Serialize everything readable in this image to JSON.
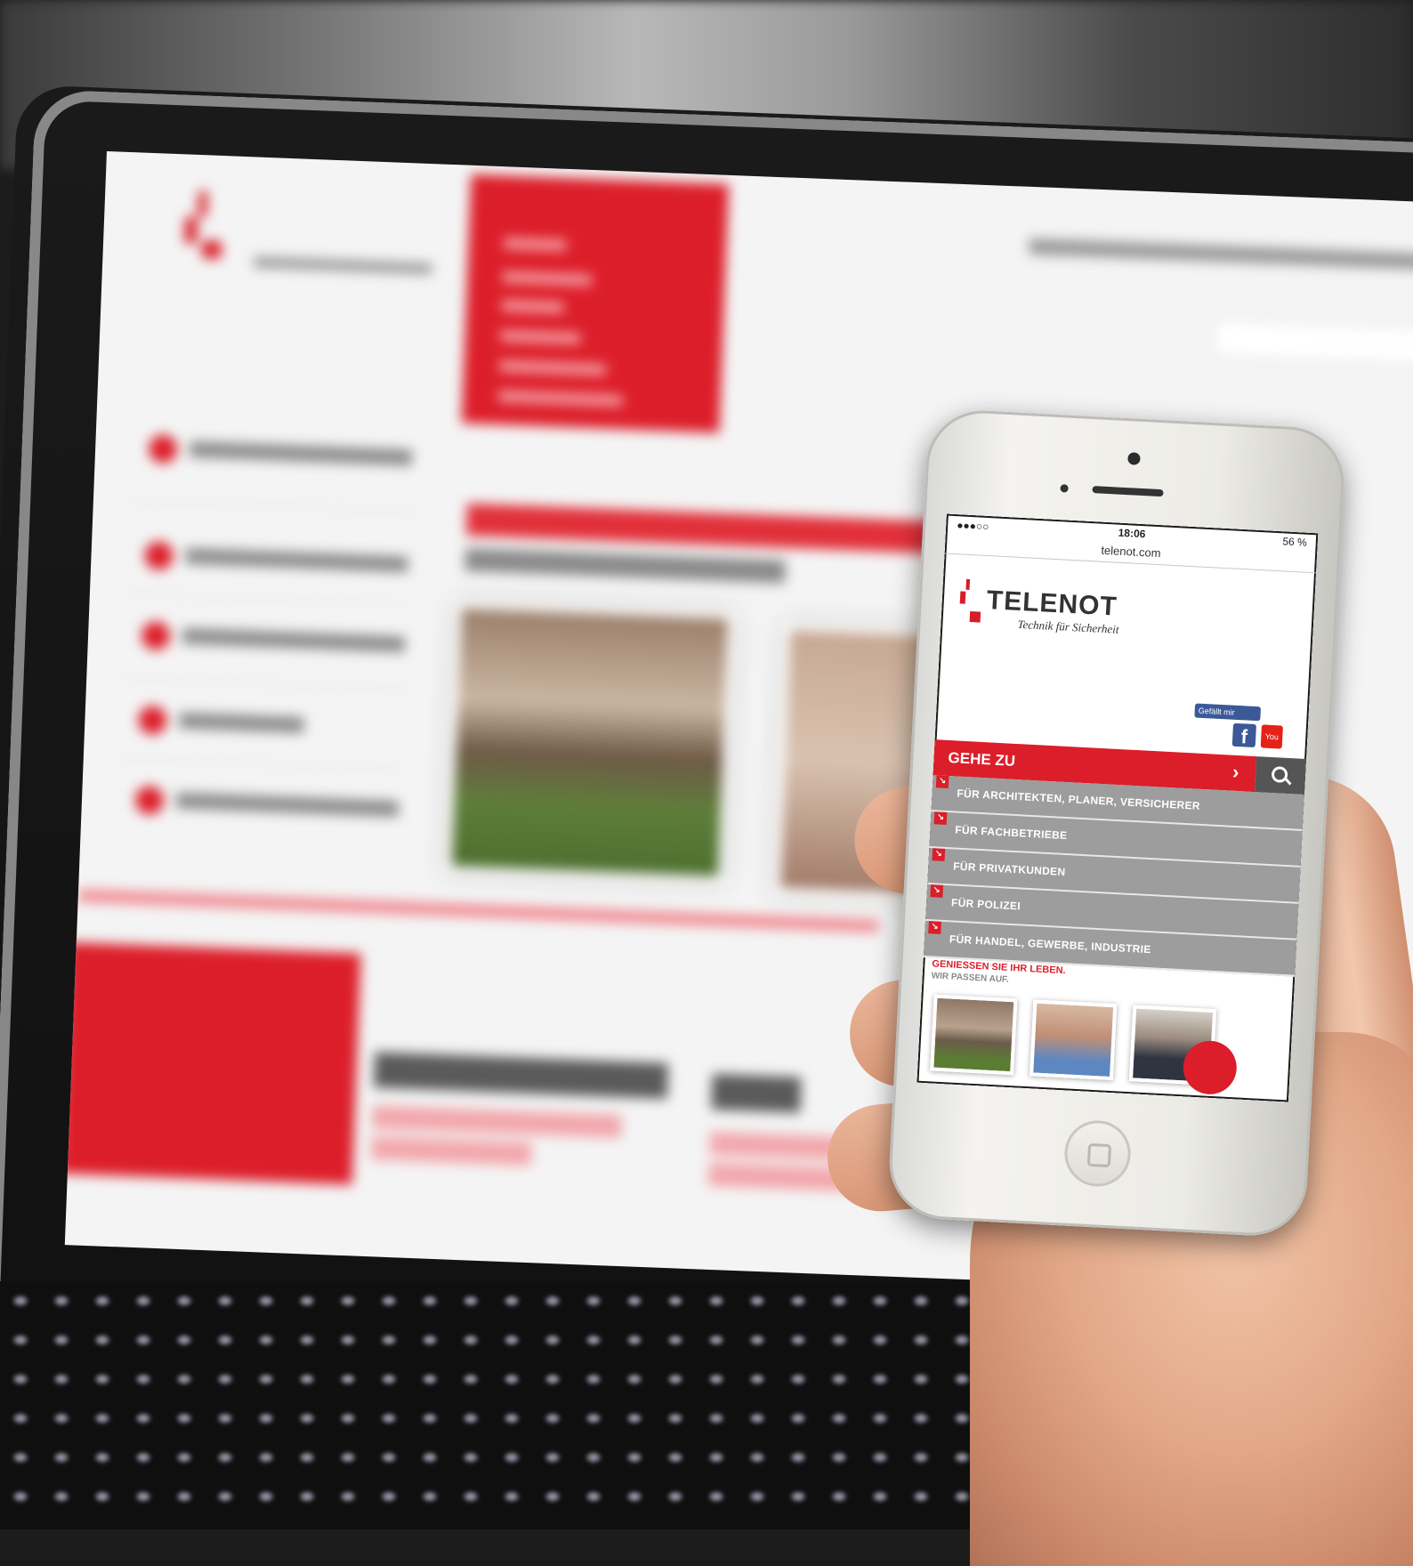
{
  "phone": {
    "status_bar": {
      "signal": "●●●○○",
      "time": "18:06",
      "battery": "56 %"
    },
    "address_bar": {
      "url": "telenot.com"
    },
    "site": {
      "logo_text": "TELENOT",
      "tagline": "Technik für Sicherheit",
      "social": {
        "facebook_like": "Gefällt mir",
        "facebook_icon": "f",
        "youtube_icon": "You"
      },
      "goto": {
        "label": "GEHE ZU",
        "arrow": "›"
      },
      "menu": [
        {
          "label": "FÜR ARCHITEKTEN, PLANER, VERSICHERER"
        },
        {
          "label": "FÜR FACHBETRIEBE"
        },
        {
          "label": "FÜR PRIVATKUNDEN"
        },
        {
          "label": "FÜR POLIZEI"
        },
        {
          "label": "FÜR HANDEL, GEWERBE, INDUSTRIE"
        }
      ],
      "teaser": {
        "title": "GENIESSEN SIE IHR LEBEN.",
        "subtitle": "WIR PASSEN AUF."
      }
    }
  },
  "colors": {
    "brand_red": "#dc1e2a",
    "menu_grey": "#9d9d9d",
    "search_dark": "#555555"
  }
}
